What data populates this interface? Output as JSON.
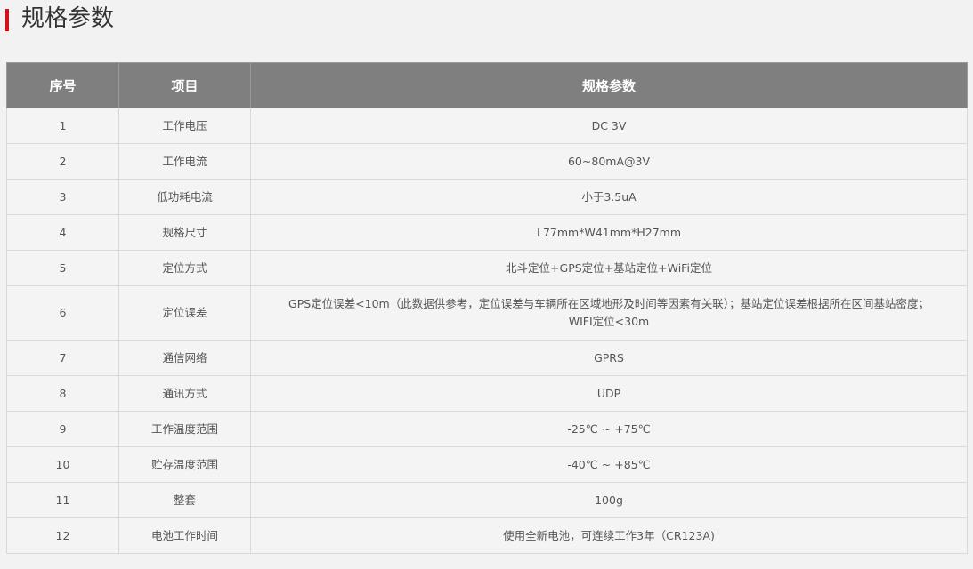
{
  "section": {
    "title": "规格参数"
  },
  "table": {
    "headers": [
      "序号",
      "项目",
      "规格参数"
    ],
    "rows": [
      {
        "no": "1",
        "item": "工作电压",
        "value": "DC 3V"
      },
      {
        "no": "2",
        "item": "工作电流",
        "value": "60~80mA@3V"
      },
      {
        "no": "3",
        "item": "低功耗电流",
        "value": "小于3.5uA"
      },
      {
        "no": "4",
        "item": "规格尺寸",
        "value": "L77mm*W41mm*H27mm"
      },
      {
        "no": "5",
        "item": "定位方式",
        "value": "北斗定位+GPS定位+基站定位+WiFi定位"
      },
      {
        "no": "6",
        "item": "定位误差",
        "value": "GPS定位误差<10m（此数据供参考，定位误差与车辆所在区域地形及时间等因素有关联）；基站定位误差根据所在区间基站密度；WIFI定位<30m"
      },
      {
        "no": "7",
        "item": "通信网络",
        "value": "GPRS"
      },
      {
        "no": "8",
        "item": "通讯方式",
        "value": "UDP"
      },
      {
        "no": "9",
        "item": "工作温度范围",
        "value": "-25℃ ~ +75℃"
      },
      {
        "no": "10",
        "item": "贮存温度范围",
        "value": "-40℃ ~ +85℃"
      },
      {
        "no": "11",
        "item": "整套",
        "value": "100g"
      },
      {
        "no": "12",
        "item": "电池工作时间",
        "value": "使用全新电池，可连续工作3年（CR123A)"
      }
    ]
  },
  "colors": {
    "accent_bar": "#d0121b",
    "header_bg": "#7f7f7f",
    "page_bg": "#f2f2f2"
  }
}
